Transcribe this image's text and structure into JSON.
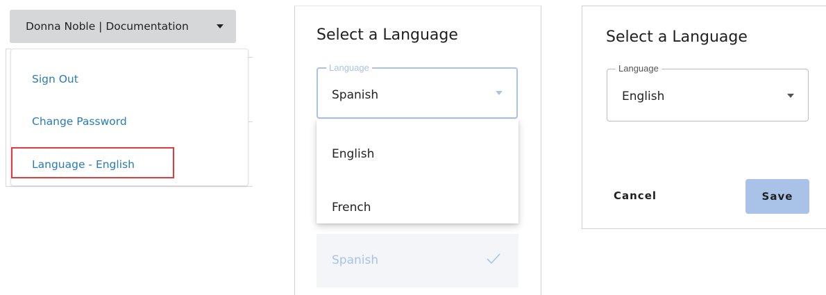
{
  "user_menu": {
    "button_label": "Donna Noble | Documentation",
    "items": [
      {
        "label": "Sign Out"
      },
      {
        "label": "Change Password"
      },
      {
        "label": "Language - English"
      }
    ]
  },
  "dialog_open": {
    "title": "Select a Language",
    "field_label": "Language",
    "field_value": "Spanish",
    "options": [
      {
        "label": "English"
      },
      {
        "label": "French"
      },
      {
        "label": "Spanish",
        "selected": true
      }
    ]
  },
  "dialog_closed": {
    "title": "Select a Language",
    "field_label": "Language",
    "field_value": "English",
    "cancel_label": "Cancel",
    "save_label": "Save"
  },
  "colors": {
    "link_blue": "#2a7ab8",
    "highlight_red": "#e23b3b",
    "accent_light_blue": "#a9c3e8",
    "button_gray": "#d6d7d9"
  },
  "icons": [
    "caret-down-icon",
    "check-icon"
  ]
}
